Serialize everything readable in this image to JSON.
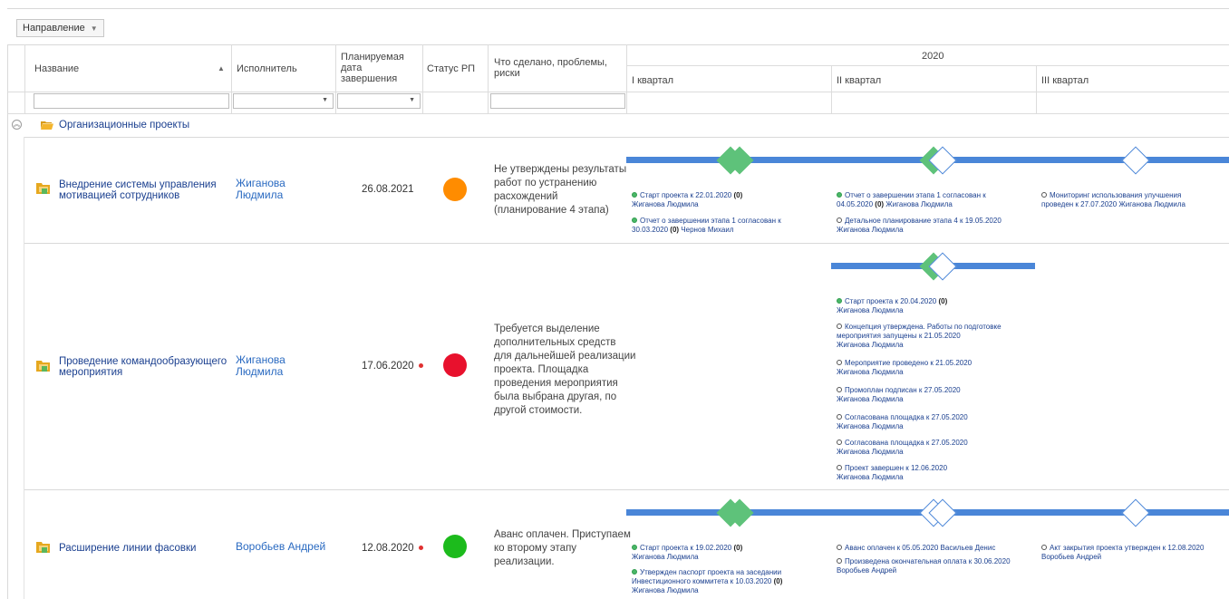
{
  "toolbar": {
    "group_by_label": "Направление"
  },
  "columns": {
    "name": "Название",
    "executor": "Исполнитель",
    "planned_date_l1": "Планируемая",
    "planned_date_l2": "дата",
    "planned_date_l3": "завершения",
    "status": "Статус РП",
    "done_l1": "Что сделано, проблемы,",
    "done_l2": "риски",
    "year": "2020",
    "q1": "I квартал",
    "q2": "II квартал",
    "q3": "III квартал"
  },
  "group": {
    "title": "Организационные проекты"
  },
  "colors": {
    "orange": "#ff8c00",
    "red": "#e8112d",
    "green": "#1cbb1c",
    "bar": "#4a86d8",
    "milestone_done": "#5ec27a"
  },
  "projects": [
    {
      "name_l1": "Внедрение системы управления",
      "name_l2": "мотивацией сотрудников",
      "executor_l1": "Жиганова",
      "executor_l2": "Людмила",
      "date": "26.08.2021",
      "status": "orange",
      "comment": [
        "Не утверждены результаты",
        "работ по устранению",
        "расхождений",
        "(планирование 4 этапа)"
      ],
      "milestones": {
        "q1": [
          {
            "state": "done",
            "l1": "Старт проекта к 22.01.2020",
            "count": "(0)",
            "l2": "Жиганова Людмила"
          },
          {
            "state": "done",
            "l1": "Отчет о завершении этапа 1 согласован к",
            "l2": "30.03.2020",
            "count": "(0)",
            "l2b": "Чернов Михаил"
          }
        ],
        "q2": [
          {
            "state": "done",
            "l1": "Отчет о завершении этапа 1 согласован к",
            "l2": "04.05.2020",
            "count": "(0)",
            "l2b": "Жиганова Людмила"
          },
          {
            "state": "open",
            "l1": "Детальное планирование этапа 4 к 19.05.2020",
            "l2": "Жиганова Людмила"
          }
        ],
        "q3": [
          {
            "state": "open",
            "l1": "Мониторинг использования улучшения",
            "l2": "проведен к 27.07.2020  Жиганова Людмила"
          }
        ]
      }
    },
    {
      "name_l1": "Проведение командообразующего",
      "name_l2": "мероприятия",
      "executor_l1": "Жиганова",
      "executor_l2": "Людмила",
      "date": "17.06.2020",
      "status": "red",
      "comment": [
        "Требуется выделение",
        "дополнительных средств",
        "для дальнейшей реализации",
        "проекта. Площадка",
        "проведения мероприятия",
        "была выбрана другая, по",
        "другой стоимости."
      ],
      "milestones": {
        "q2": [
          {
            "state": "done",
            "l1": "Старт проекта к 20.04.2020",
            "count": "(0)",
            "l2": "Жиганова Людмила"
          },
          {
            "state": "open",
            "l1": "Концепция утверждена. Работы по подготовке",
            "l2": "мероприятия запущены к 21.05.2020",
            "l3": "Жиганова Людмила"
          },
          {
            "state": "open",
            "l1": "Мероприятие проведено к 21.05.2020",
            "l2": "Жиганова Людмила"
          },
          {
            "state": "open",
            "l1": "Промоплан подписан к 27.05.2020",
            "l2": "Жиганова Людмила"
          },
          {
            "state": "open",
            "l1": "Согласована площадка к 27.05.2020",
            "l2": "Жиганова Людмила"
          },
          {
            "state": "open",
            "l1": "Согласована площадка к 27.05.2020",
            "l2": "Жиганова Людмила"
          },
          {
            "state": "open",
            "l1": "Проект завершен к 12.06.2020",
            "l2": "Жиганова Людмила"
          }
        ]
      }
    },
    {
      "name_l1": "Расширение линии фасовки",
      "executor_l1": "Воробьев Андрей",
      "date": "12.08.2020",
      "status": "green",
      "comment": [
        "Аванс оплачен. Приступаем",
        "ко второму этапу",
        "реализации."
      ],
      "milestones": {
        "q1": [
          {
            "state": "done",
            "l1": "Старт проекта к 19.02.2020",
            "count": "(0)",
            "l2": "Жиганова Людмила"
          },
          {
            "state": "done",
            "l1": "Утвержден паспорт проекта на заседании",
            "l2": "Инвестиционного коммитета к 10.03.2020",
            "count": "(0)",
            "l3": "Жиганова Людмила"
          }
        ],
        "q2": [
          {
            "state": "open",
            "l1": "Аванс оплачен к 05.05.2020  Васильев Денис"
          },
          {
            "state": "open",
            "l1": "Произведена окончательная оплата к 30.06.2020",
            "l2": "Воробьев Андрей"
          }
        ],
        "q3": [
          {
            "state": "open",
            "l1": "Акт закрытия проекта утвержден к 12.08.2020",
            "l2": "Воробьев Андрей"
          }
        ]
      }
    }
  ]
}
